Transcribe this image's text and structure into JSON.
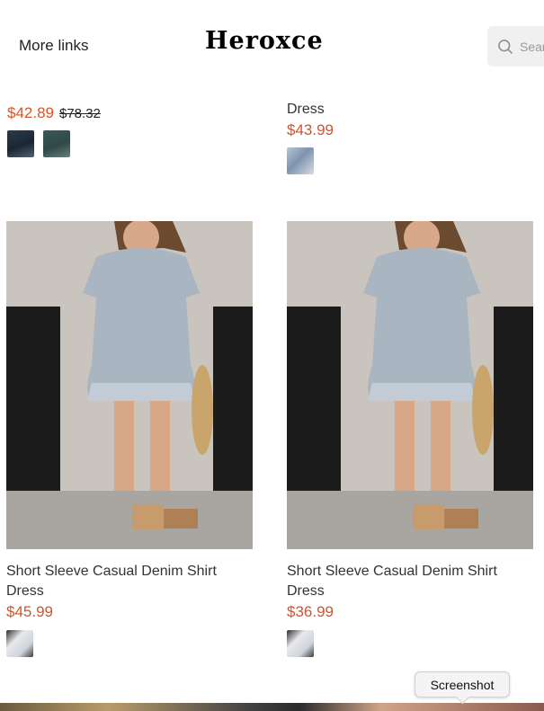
{
  "header": {
    "more_links": "More links",
    "logo": "Heroxce",
    "search_placeholder": "Search"
  },
  "products_top": [
    {
      "name": "",
      "price": "$42.89",
      "compare_price": "$78.32",
      "swatches": [
        "navy",
        "teal"
      ]
    },
    {
      "name": "Dress",
      "price": "$43.99",
      "compare_price": "",
      "swatches": [
        "denim"
      ]
    }
  ],
  "products": [
    {
      "name": "Short Sleeve Casual Denim Shirt Dress",
      "price": "$45.99",
      "swatches": [
        "light-denim"
      ]
    },
    {
      "name": "Short Sleeve Casual Denim Shirt Dress",
      "price": "$36.99",
      "swatches": [
        "light-denim"
      ]
    }
  ],
  "tooltip": "Screenshot",
  "colors": {
    "price": "#d4542b",
    "search_bg": "#f0f0f0"
  }
}
